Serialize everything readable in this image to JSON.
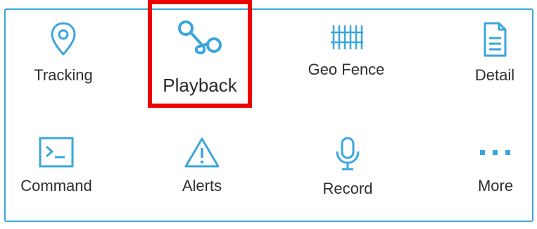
{
  "colors": {
    "accent": "#3aa6dd",
    "highlight": "#ee0000",
    "text": "#2f2f2f"
  },
  "menu": {
    "items": [
      {
        "label": "Tracking",
        "icon": "location-pin-icon"
      },
      {
        "label": "Playback",
        "icon": "route-playback-icon"
      },
      {
        "label": "Geo Fence",
        "icon": "fence-icon"
      },
      {
        "label": "Detail",
        "icon": "document-icon"
      },
      {
        "label": "Command",
        "icon": "terminal-icon"
      },
      {
        "label": "Alerts",
        "icon": "warning-icon"
      },
      {
        "label": "Record",
        "icon": "microphone-icon"
      },
      {
        "label": "More",
        "icon": "more-dots-icon"
      }
    ]
  }
}
